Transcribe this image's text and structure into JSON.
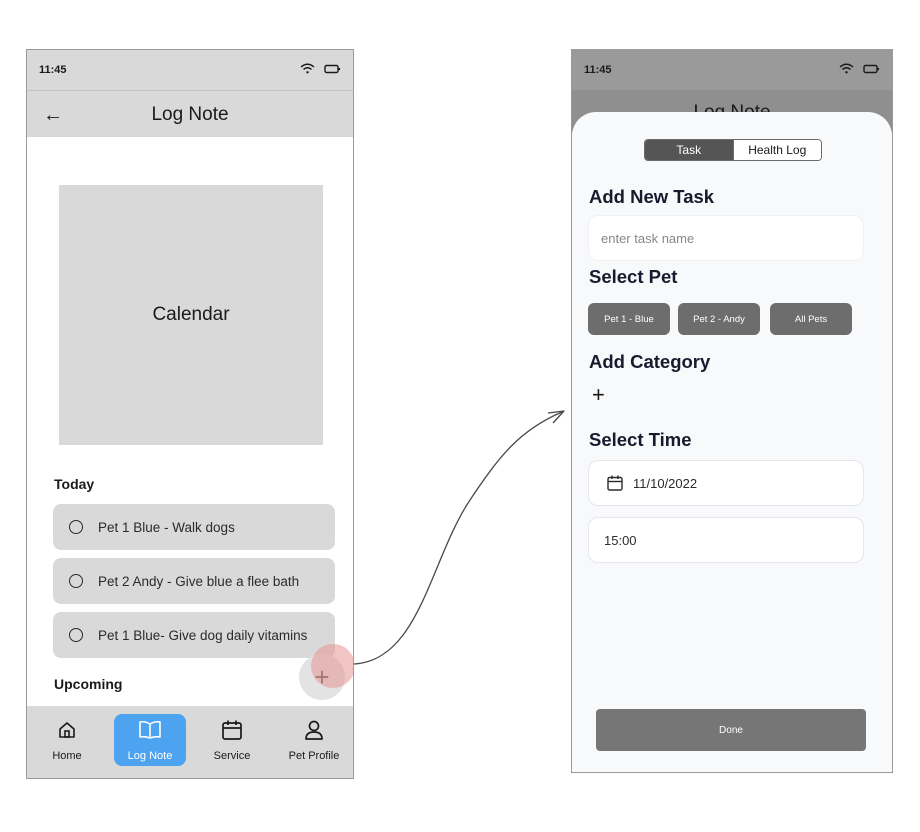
{
  "left_screen": {
    "status": {
      "time": "11:45",
      "wifi_icon": "wifi-icon",
      "battery_icon": "battery-icon"
    },
    "header": {
      "back_icon": "←",
      "title": "Log Note"
    },
    "calendar_label": "Calendar",
    "today": {
      "heading": "Today",
      "tasks": [
        {
          "label": "Pet 1 Blue - Walk dogs"
        },
        {
          "label": "Pet 2 Andy - Give blue a flee bath"
        },
        {
          "label": "Pet 1 Blue- Give dog daily vitamins"
        }
      ]
    },
    "upcoming": {
      "heading": "Upcoming"
    },
    "fab": {
      "symbol": "+"
    },
    "nav": [
      {
        "label": "Home",
        "icon": "home-icon"
      },
      {
        "label": "Log Note",
        "icon": "book-icon",
        "active": true
      },
      {
        "label": "Service",
        "icon": "calendar-icon"
      },
      {
        "label": "Pet Profile",
        "icon": "user-icon"
      }
    ],
    "colors": {
      "active_nav": "#4da3f0",
      "surface": "#d9d9d9"
    }
  },
  "right_screen": {
    "status": {
      "time": "11:45"
    },
    "underlay": {
      "back_icon": "←",
      "title": "Log Note"
    },
    "segments": {
      "task": "Task",
      "health_log": "Health Log"
    },
    "add_task": {
      "heading": "Add New Task",
      "placeholder": "enter task name"
    },
    "select_pet": {
      "heading": "Select Pet",
      "chips": [
        "Pet 1 - Blue",
        "Pet 2 - Andy",
        "All Pets"
      ]
    },
    "add_category": {
      "heading": "Add Category",
      "add_symbol": "+"
    },
    "select_time": {
      "heading": "Select Time",
      "date": "11/10/2022",
      "time": "15:00"
    },
    "done_label": "Done",
    "colors": {
      "chip": "#6d6d6d",
      "sheet": "#f8f9fb",
      "button": "#767676"
    }
  }
}
